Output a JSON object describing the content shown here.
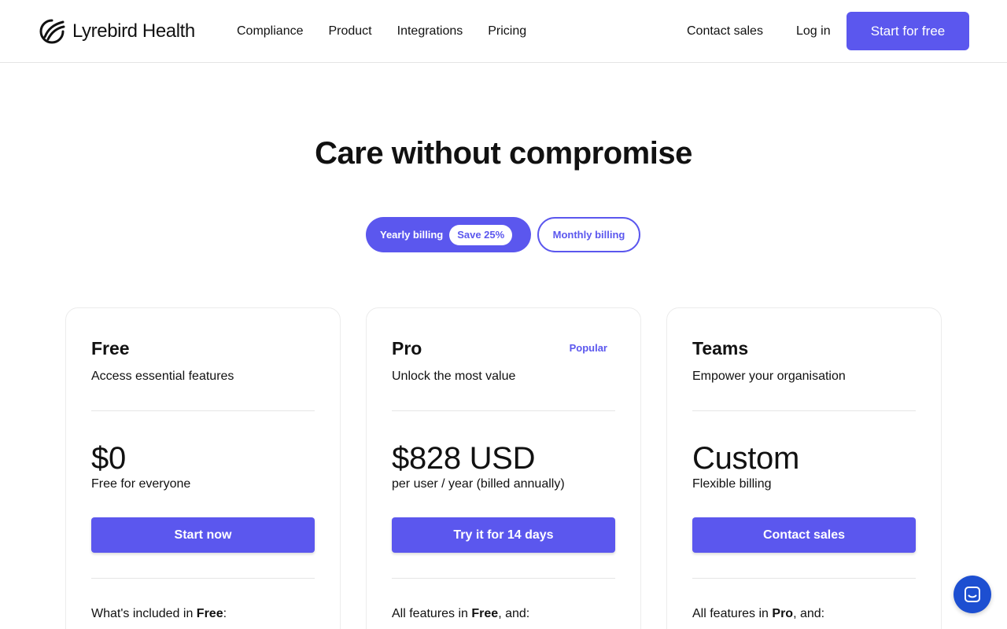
{
  "brand": {
    "name": "Lyrebird Health",
    "accent": "#5b57ee",
    "logo_icon": "lyrebird-logo-icon"
  },
  "nav": {
    "items": [
      {
        "label": "Compliance"
      },
      {
        "label": "Product"
      },
      {
        "label": "Integrations"
      },
      {
        "label": "Pricing"
      }
    ],
    "contact_sales": "Contact sales",
    "log_in": "Log in",
    "start_free": "Start for free"
  },
  "hero": {
    "title": "Care without compromise"
  },
  "billing_toggle": {
    "yearly_label": "Yearly billing",
    "save_badge": "Save 25%",
    "monthly_label": "Monthly billing",
    "selected": "yearly"
  },
  "plans": [
    {
      "name": "Free",
      "tag": "",
      "description": "Access essential features",
      "price": "$0",
      "period": "Free for everyone",
      "cta": "Start now",
      "features_prefix": "What's included in ",
      "features_bold": "Free",
      "features_suffix": ":"
    },
    {
      "name": "Pro",
      "tag": "Popular",
      "description": "Unlock the most value",
      "price": "$828 USD",
      "period": "per user / year (billed annually)",
      "cta": "Try it for 14 days",
      "features_prefix": "All features in ",
      "features_bold": "Free",
      "features_suffix": ", and:"
    },
    {
      "name": "Teams",
      "tag": "",
      "description": "Empower your organisation",
      "price": "Custom",
      "period": "Flexible billing",
      "cta": "Contact sales",
      "features_prefix": "All features in ",
      "features_bold": "Pro",
      "features_suffix": ", and:"
    }
  ],
  "chat": {
    "icon": "chat-icon",
    "color": "#1d4fd1"
  }
}
